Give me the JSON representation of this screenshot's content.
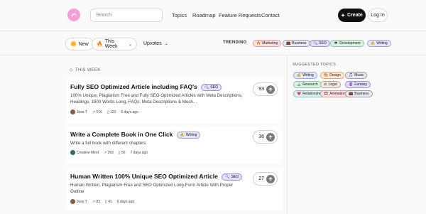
{
  "header": {
    "search_placeholder": "Search",
    "nav": [
      "Topics",
      "Roadmap",
      "Feature Requests",
      "Contact"
    ],
    "create_label": "Create",
    "login_label": "Log In"
  },
  "filters": {
    "new_label": "New",
    "period_label": "This Week",
    "sort_label": "Upvotes",
    "trending_label": "TRENDING",
    "trending_tags": [
      {
        "label": "Marketing",
        "emoji": "🔥",
        "bg": "#fde0e0",
        "border": "#e89a9a"
      },
      {
        "label": "Business",
        "emoji": "💼",
        "bg": "#e8e8ef",
        "border": "#9a9ab0"
      },
      {
        "label": "SEO",
        "emoji": "🔍",
        "bg": "#e4e0fa",
        "border": "#9890d8"
      },
      {
        "label": "Development",
        "emoji": "💻",
        "bg": "#dcf3e4",
        "border": "#88c8a0"
      },
      {
        "label": "Writing",
        "emoji": "✍",
        "bg": "#e4e6fb",
        "border": "#9aa0e0"
      }
    ]
  },
  "feed": {
    "section_label": "THIS WEEK",
    "posts": [
      {
        "title": "Fully SEO Optimized Article including FAQ's",
        "tag": "SEO",
        "tag_emoji": "🔍",
        "desc": "100% Unique, Plagiarism Free and Fully SEO Optimized Articles with Meta Descriptions, Headings, 1500 Words Long, FAQs, Meta Descriptions & Much...",
        "author": "Jose T",
        "views": "516",
        "saves": "120",
        "time": "6 days ago",
        "votes": "93"
      },
      {
        "title": "Write a Complete Book in One Click",
        "tag": "Writing",
        "tag_emoji": "✍",
        "desc": "Write a full book with different chapters",
        "author": "Creative Mind",
        "views": "393",
        "saves": "56",
        "time": "7 days ago",
        "votes": "36"
      },
      {
        "title": "Human Written 100% Unique SEO Optimized Article",
        "tag": "SEO",
        "tag_emoji": "🔍",
        "desc": "Human Written, Plagiarism Free and SEO Optimized Long-Form Article With Proper Outline",
        "author": "Jose T",
        "views": "83",
        "saves": "41",
        "time": "6 days ago",
        "votes": "27"
      }
    ]
  },
  "sidebar": {
    "label": "SUGGESTED TOPICS",
    "topics": [
      {
        "label": "Writing",
        "emoji": "✍",
        "bg": "#e4e6fb",
        "border": "#9aa0e0"
      },
      {
        "label": "Design",
        "emoji": "🎨",
        "bg": "#fde8d6",
        "border": "#e0a878"
      },
      {
        "label": "Music",
        "emoji": "🎵",
        "bg": "#e8e8ef",
        "border": "#9a9ab0"
      },
      {
        "label": "Research",
        "emoji": "🔬",
        "bg": "#dcf3e4",
        "border": "#88c8a0"
      },
      {
        "label": "Legal",
        "emoji": "⚖",
        "bg": "#f0eae0",
        "border": "#b8a888"
      },
      {
        "label": "Fantasy",
        "emoji": "🔮",
        "bg": "#e4e0fa",
        "border": "#9890d8"
      },
      {
        "label": "Relationship",
        "emoji": "💗",
        "bg": "#dcf0f0",
        "border": "#88c0c0"
      },
      {
        "label": "Animation",
        "emoji": "🎞",
        "bg": "#fde0e0",
        "border": "#e89a9a"
      },
      {
        "label": "Business",
        "emoji": "💼",
        "bg": "#e8e8ef",
        "border": "#9a9ab0"
      }
    ]
  }
}
